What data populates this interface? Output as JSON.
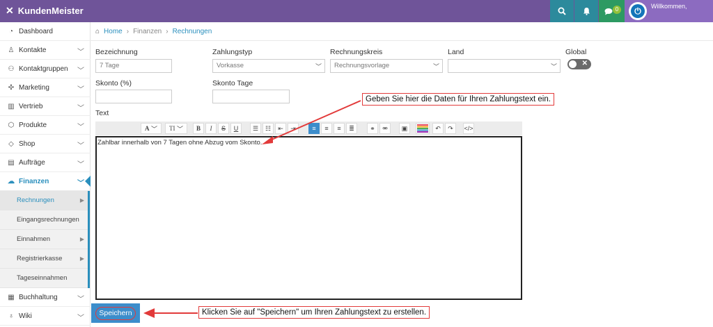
{
  "app": {
    "brand": "KundenMeister"
  },
  "topbar": {
    "chat_count": "0",
    "welcome": "Willkommen,"
  },
  "sidebar": {
    "items": [
      {
        "label": "Dashboard",
        "icon": "dashboard-icon",
        "glyph": "◔"
      },
      {
        "label": "Kontakte",
        "icon": "contacts-icon",
        "glyph": "♙"
      },
      {
        "label": "Kontaktgruppen",
        "icon": "groups-icon",
        "glyph": "⚇"
      },
      {
        "label": "Marketing",
        "icon": "marketing-icon",
        "glyph": "✣"
      },
      {
        "label": "Vertrieb",
        "icon": "sales-icon",
        "glyph": "▥"
      },
      {
        "label": "Produkte",
        "icon": "products-icon",
        "glyph": "⬡"
      },
      {
        "label": "Shop",
        "icon": "shop-icon",
        "glyph": "◇"
      },
      {
        "label": "Aufträge",
        "icon": "orders-icon",
        "glyph": "▤"
      },
      {
        "label": "Finanzen",
        "icon": "cloud-icon",
        "glyph": "☁"
      }
    ],
    "sub_items": [
      {
        "label": "Rechnungen"
      },
      {
        "label": "Eingangsrechnungen"
      },
      {
        "label": "Einnahmen"
      },
      {
        "label": "Registrierkasse"
      },
      {
        "label": "Tageseinnahmen"
      }
    ],
    "bottom_items": [
      {
        "label": "Buchhaltung",
        "icon": "accounting-icon",
        "glyph": "▦"
      },
      {
        "label": "Wiki",
        "icon": "wiki-icon",
        "glyph": "♁"
      }
    ]
  },
  "breadcrumb": {
    "home": "Home",
    "finanzen": "Finanzen",
    "current": "Rechnungen"
  },
  "form": {
    "bezeichnung_label": "Bezeichnung",
    "bezeichnung_value": "7 Tage",
    "zahlungstyp_label": "Zahlungstyp",
    "zahlungstyp_value": "Vorkasse",
    "rechnungskreis_label": "Rechnungskreis",
    "rechnungskreis_value": "Rechnungsvorlage",
    "land_label": "Land",
    "land_value": "",
    "global_label": "Global",
    "skonto_label": "Skonto (%)",
    "skonto_tage_label": "Skonto Tage",
    "text_label": "Text",
    "editor_text": "Zahlbar innerhalb von 7 Tagen ohne Abzug vom Skonto."
  },
  "toolbar": {
    "font_label": "A",
    "size_label": "TI"
  },
  "save_button": "Speichern",
  "annotations": {
    "callout_text": "Geben Sie hier die Daten für Ihren Zahlungstext ein.",
    "callout_save": "Klicken Sie auf \"Speichern\" um Ihren Zahlungstext zu erstellen.",
    "accent": "#e23a3a"
  },
  "colors": {
    "topbar": "#6f5499",
    "primary": "#3c8dcb",
    "link": "#2a8fbd"
  }
}
